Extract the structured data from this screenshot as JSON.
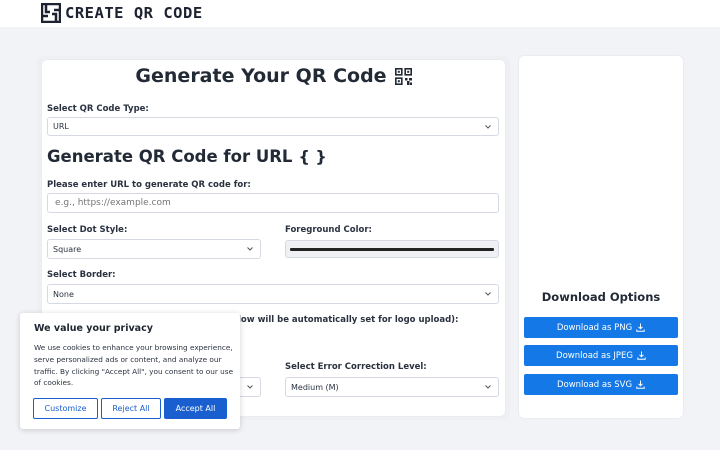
{
  "header": {
    "logo_text": "CREATE QR CODE"
  },
  "main": {
    "title": "Generate Your QR Code",
    "qr_type_label": "Select QR Code Type:",
    "qr_type_value": "URL",
    "section_title": "Generate QR Code for URL",
    "section_icon": "{ }",
    "url_label": "Please enter URL to generate QR code for:",
    "url_placeholder": "e.g., https://example.com",
    "dot_style_label": "Select Dot Style:",
    "dot_style_value": "Square",
    "fg_color_label": "Foreground Color:",
    "fg_color_value": "#222222",
    "border_label": "Select Border:",
    "border_value": "None",
    "logo_note_label": "low will be automatically set for logo upload):",
    "error_label": "Select Error Correction Level:",
    "error_value": "Medium (M)"
  },
  "download": {
    "title": "Download Options",
    "png_label": "Download as PNG",
    "jpeg_label": "Download as JPEG",
    "svg_label": "Download as SVG",
    "icon": "download-icon",
    "button_color": "#1479e6"
  },
  "cookie_banner": {
    "title": "We value your privacy",
    "body": "We use cookies to enhance your browsing experience, serve personalized ads or content, and analyze our traffic. By clicking \"Accept All\", you consent to our use of cookies.",
    "customize_label": "Customize",
    "reject_label": "Reject All",
    "accept_label": "Accept All",
    "accent_color": "#1a5fd0"
  }
}
